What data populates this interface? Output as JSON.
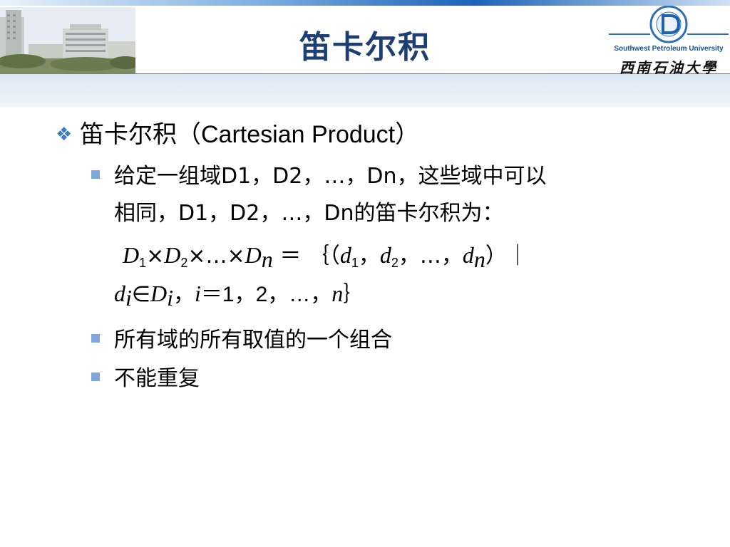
{
  "slide": {
    "title": "笛卡尔积"
  },
  "logo": {
    "university_en": "Southwest Petroleum University",
    "university_cn": "西南石油大學"
  },
  "content": {
    "heading": {
      "icon": "diamond-bullet-icon",
      "text_cn": "笛卡尔积（",
      "text_en": "Cartesian Product",
      "text_close": "）"
    },
    "bullets": [
      "给定一组域D1，D2，…，Dn，这些域中可以",
      "相同，D1，D2，…，Dn的笛卡尔积为：",
      "所有域的所有取值的一个组合",
      "不能重复"
    ],
    "formula": {
      "D": "D",
      "s1": "1",
      "s2": "2",
      "times": "×",
      "ellipsis": "…",
      "sn": "n",
      "eq": " ＝ ｛（",
      "d": "d",
      "comma": "，",
      "close": "）｜",
      "in": "∈",
      "si": "i",
      "i": "i",
      "rest": "＝1，2，…，",
      "n": "n",
      "brace": "｝"
    }
  },
  "colors": {
    "title": "#1e3f74",
    "accent": "#3a7fc4",
    "bullet": "#7fa6d8",
    "header_line": "#4a8ad0"
  }
}
